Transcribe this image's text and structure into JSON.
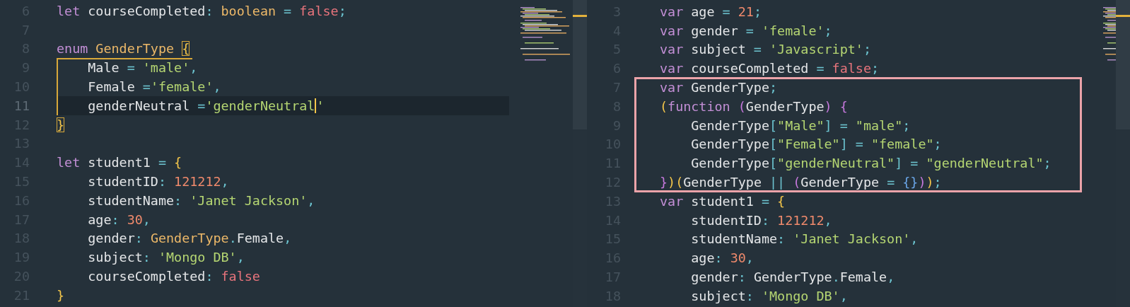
{
  "panes": [
    {
      "kind": "typescript",
      "blocks": [
        {
          "kind": "plain",
          "lines": [
            {
              "number": "6",
              "active": false,
              "tokens": [
                {
                  "kind": "kw",
                  "text": "let"
                },
                {
                  "kind": "ident",
                  "text": " courseCompleted"
                },
                {
                  "kind": "punct",
                  "text": ": "
                },
                {
                  "kind": "type",
                  "text": "boolean"
                },
                {
                  "kind": "punct",
                  "text": " = "
                },
                {
                  "kind": "bool",
                  "text": "false"
                },
                {
                  "kind": "punct",
                  "text": ";"
                }
              ]
            },
            {
              "number": "7",
              "active": false
            },
            {
              "number": "8",
              "active": false,
              "tokens": [
                {
                  "kind": "kw",
                  "text": "enum"
                },
                {
                  "kind": "type",
                  "text": " GenderType "
                },
                {
                  "kind": "match",
                  "text": "{"
                }
              ]
            }
          ]
        },
        {
          "kind": "scope",
          "lines": [
            {
              "number": "9",
              "active": false,
              "tokens": [
                {
                  "kind": "ident",
                  "text": "    Male"
                },
                {
                  "kind": "punct",
                  "text": " = "
                },
                {
                  "kind": "str",
                  "text": "'male'"
                },
                {
                  "kind": "punct",
                  "text": ","
                }
              ]
            },
            {
              "number": "10",
              "active": false,
              "tokens": [
                {
                  "kind": "ident",
                  "text": "    Female"
                },
                {
                  "kind": "punct",
                  "text": " ="
                },
                {
                  "kind": "str",
                  "text": "'female'"
                },
                {
                  "kind": "punct",
                  "text": ","
                }
              ]
            },
            {
              "number": "11",
              "active": true,
              "tokens": [
                {
                  "kind": "ident",
                  "text": "    genderNeutral"
                },
                {
                  "kind": "punct",
                  "text": " ="
                },
                {
                  "kind": "str-caret",
                  "text": "'genderNeutral"
                },
                {
                  "kind": "str",
                  "text": "'"
                }
              ]
            }
          ]
        },
        {
          "kind": "plain",
          "lines": [
            {
              "number": "12",
              "active": false,
              "tokens": [
                {
                  "kind": "match",
                  "text": "}"
                }
              ]
            },
            {
              "number": "13",
              "active": false
            },
            {
              "number": "14",
              "active": false,
              "tokens": [
                {
                  "kind": "kw",
                  "text": "let"
                },
                {
                  "kind": "ident",
                  "text": " student1"
                },
                {
                  "kind": "punct",
                  "text": " = "
                },
                {
                  "kind": "br1",
                  "text": "{"
                }
              ]
            },
            {
              "number": "15",
              "active": false,
              "tokens": [
                {
                  "kind": "ident",
                  "text": "    studentID"
                },
                {
                  "kind": "punct",
                  "text": ": "
                },
                {
                  "kind": "num",
                  "text": "121212"
                },
                {
                  "kind": "punct",
                  "text": ","
                }
              ]
            },
            {
              "number": "16",
              "active": false,
              "tokens": [
                {
                  "kind": "ident",
                  "text": "    studentName"
                },
                {
                  "kind": "punct",
                  "text": ": "
                },
                {
                  "kind": "str",
                  "text": "'Janet Jackson'"
                },
                {
                  "kind": "punct",
                  "text": ","
                }
              ]
            },
            {
              "number": "17",
              "active": false,
              "tokens": [
                {
                  "kind": "ident",
                  "text": "    age"
                },
                {
                  "kind": "punct",
                  "text": ": "
                },
                {
                  "kind": "num",
                  "text": "30"
                },
                {
                  "kind": "punct",
                  "text": ","
                }
              ]
            },
            {
              "number": "18",
              "active": false,
              "tokens": [
                {
                  "kind": "ident",
                  "text": "    gender"
                },
                {
                  "kind": "punct",
                  "text": ": "
                },
                {
                  "kind": "type",
                  "text": "GenderType"
                },
                {
                  "kind": "punct",
                  "text": "."
                },
                {
                  "kind": "ident",
                  "text": "Female"
                },
                {
                  "kind": "punct",
                  "text": ","
                }
              ]
            },
            {
              "number": "19",
              "active": false,
              "tokens": [
                {
                  "kind": "ident",
                  "text": "    subject"
                },
                {
                  "kind": "punct",
                  "text": ": "
                },
                {
                  "kind": "str",
                  "text": "'Mongo DB'"
                },
                {
                  "kind": "punct",
                  "text": ","
                }
              ]
            },
            {
              "number": "20",
              "active": false,
              "tokens": [
                {
                  "kind": "ident",
                  "text": "    courseCompleted"
                },
                {
                  "kind": "punct",
                  "text": ": "
                },
                {
                  "kind": "bool",
                  "text": "false"
                }
              ]
            },
            {
              "number": "21",
              "active": false,
              "tokens": [
                {
                  "kind": "br1",
                  "text": "}"
                }
              ]
            }
          ]
        }
      ]
    },
    {
      "kind": "javascript",
      "blocks": [
        {
          "kind": "plain",
          "lines": [
            {
              "number": "3",
              "active": false,
              "tokens": [
                {
                  "kind": "kw",
                  "text": "var"
                },
                {
                  "kind": "ident",
                  "text": " age"
                },
                {
                  "kind": "punct",
                  "text": " = "
                },
                {
                  "kind": "num",
                  "text": "21"
                },
                {
                  "kind": "punct",
                  "text": ";"
                }
              ]
            },
            {
              "number": "4",
              "active": false,
              "tokens": [
                {
                  "kind": "kw",
                  "text": "var"
                },
                {
                  "kind": "ident",
                  "text": " gender"
                },
                {
                  "kind": "punct",
                  "text": " = "
                },
                {
                  "kind": "str",
                  "text": "'female'"
                },
                {
                  "kind": "punct",
                  "text": ";"
                }
              ]
            },
            {
              "number": "5",
              "active": false,
              "tokens": [
                {
                  "kind": "kw",
                  "text": "var"
                },
                {
                  "kind": "ident",
                  "text": " subject"
                },
                {
                  "kind": "punct",
                  "text": " = "
                },
                {
                  "kind": "str",
                  "text": "'Javascript'"
                },
                {
                  "kind": "punct",
                  "text": ";"
                }
              ]
            },
            {
              "number": "6",
              "active": false,
              "tokens": [
                {
                  "kind": "kw",
                  "text": "var"
                },
                {
                  "kind": "ident",
                  "text": " courseCompleted"
                },
                {
                  "kind": "punct",
                  "text": " = "
                },
                {
                  "kind": "bool",
                  "text": "false"
                },
                {
                  "kind": "punct",
                  "text": ";"
                }
              ]
            }
          ]
        },
        {
          "kind": "boxed",
          "lines": [
            {
              "number": "7",
              "active": false,
              "tokens": [
                {
                  "kind": "kw",
                  "text": "var"
                },
                {
                  "kind": "ident",
                  "text": " GenderType"
                },
                {
                  "kind": "punct",
                  "text": ";"
                }
              ]
            },
            {
              "number": "8",
              "active": false,
              "tokens": [
                {
                  "kind": "br1",
                  "text": "("
                },
                {
                  "kind": "kw",
                  "text": "function "
                },
                {
                  "kind": "br2",
                  "text": "("
                },
                {
                  "kind": "ident",
                  "text": "GenderType"
                },
                {
                  "kind": "br2",
                  "text": ") {"
                }
              ]
            },
            {
              "number": "9",
              "active": false,
              "tokens": [
                {
                  "kind": "ident",
                  "text": "    GenderType"
                },
                {
                  "kind": "punct",
                  "text": "["
                },
                {
                  "kind": "str",
                  "text": "\"Male\""
                },
                {
                  "kind": "punct",
                  "text": "] = "
                },
                {
                  "kind": "str",
                  "text": "\"male\""
                },
                {
                  "kind": "punct",
                  "text": ";"
                }
              ]
            },
            {
              "number": "10",
              "active": false,
              "tokens": [
                {
                  "kind": "ident",
                  "text": "    GenderType"
                },
                {
                  "kind": "punct",
                  "text": "["
                },
                {
                  "kind": "str",
                  "text": "\"Female\""
                },
                {
                  "kind": "punct",
                  "text": "] = "
                },
                {
                  "kind": "str",
                  "text": "\"female\""
                },
                {
                  "kind": "punct",
                  "text": ";"
                }
              ]
            },
            {
              "number": "11",
              "active": false,
              "tokens": [
                {
                  "kind": "ident",
                  "text": "    GenderType"
                },
                {
                  "kind": "punct",
                  "text": "["
                },
                {
                  "kind": "str",
                  "text": "\"genderNeutral\""
                },
                {
                  "kind": "punct",
                  "text": "] = "
                },
                {
                  "kind": "str",
                  "text": "\"genderNeutral\""
                },
                {
                  "kind": "punct",
                  "text": ";"
                }
              ]
            },
            {
              "number": "12",
              "active": false,
              "tokens": [
                {
                  "kind": "br2",
                  "text": "}"
                },
                {
                  "kind": "br1",
                  "text": ")("
                },
                {
                  "kind": "ident",
                  "text": "GenderType "
                },
                {
                  "kind": "punct",
                  "text": "|| "
                },
                {
                  "kind": "br2",
                  "text": "("
                },
                {
                  "kind": "ident",
                  "text": "GenderType"
                },
                {
                  "kind": "punct",
                  "text": " = "
                },
                {
                  "kind": "br3",
                  "text": "{}"
                },
                {
                  "kind": "br2",
                  "text": ")"
                },
                {
                  "kind": "br1",
                  "text": ")"
                },
                {
                  "kind": "punct",
                  "text": ";"
                }
              ]
            }
          ]
        },
        {
          "kind": "plain",
          "lines": [
            {
              "number": "13",
              "active": false,
              "tokens": [
                {
                  "kind": "kw",
                  "text": "var"
                },
                {
                  "kind": "ident",
                  "text": " student1"
                },
                {
                  "kind": "punct",
                  "text": " = "
                },
                {
                  "kind": "br1",
                  "text": "{"
                }
              ]
            },
            {
              "number": "14",
              "active": false,
              "tokens": [
                {
                  "kind": "ident",
                  "text": "    studentID"
                },
                {
                  "kind": "punct",
                  "text": ": "
                },
                {
                  "kind": "num",
                  "text": "121212"
                },
                {
                  "kind": "punct",
                  "text": ","
                }
              ]
            },
            {
              "number": "15",
              "active": false,
              "tokens": [
                {
                  "kind": "ident",
                  "text": "    studentName"
                },
                {
                  "kind": "punct",
                  "text": ": "
                },
                {
                  "kind": "str",
                  "text": "'Janet Jackson'"
                },
                {
                  "kind": "punct",
                  "text": ","
                }
              ]
            },
            {
              "number": "16",
              "active": false,
              "tokens": [
                {
                  "kind": "ident",
                  "text": "    age"
                },
                {
                  "kind": "punct",
                  "text": ": "
                },
                {
                  "kind": "num",
                  "text": "30"
                },
                {
                  "kind": "punct",
                  "text": ","
                }
              ]
            },
            {
              "number": "17",
              "active": false,
              "tokens": [
                {
                  "kind": "ident",
                  "text": "    gender"
                },
                {
                  "kind": "punct",
                  "text": ": "
                },
                {
                  "kind": "ident",
                  "text": "GenderType"
                },
                {
                  "kind": "punct",
                  "text": "."
                },
                {
                  "kind": "ident",
                  "text": "Female"
                },
                {
                  "kind": "punct",
                  "text": ","
                }
              ]
            },
            {
              "number": "18",
              "active": false,
              "tokens": [
                {
                  "kind": "ident",
                  "text": "    subject"
                },
                {
                  "kind": "punct",
                  "text": ": "
                },
                {
                  "kind": "str",
                  "text": "'Mongo DB'"
                },
                {
                  "kind": "punct",
                  "text": ","
                }
              ]
            }
          ]
        }
      ]
    }
  ]
}
